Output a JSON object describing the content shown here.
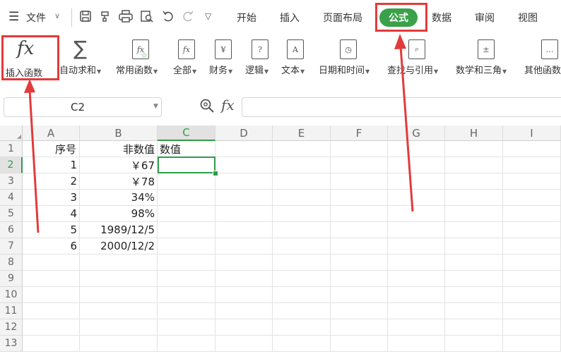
{
  "menubar": {
    "file_label": "文件",
    "tabs": [
      "开始",
      "插入",
      "页面布局",
      "公式",
      "数据",
      "审阅",
      "视图"
    ],
    "active_tab": "公式"
  },
  "ribbon": {
    "items": [
      {
        "label": "插入函数",
        "icon": "fx-icon"
      },
      {
        "label": "自动求和",
        "icon": "sigma-icon"
      },
      {
        "label": "常用函数",
        "icon": "star-fx-icon"
      },
      {
        "label": "全部",
        "icon": "fx-book-icon"
      },
      {
        "label": "财务",
        "icon": "yen-book-icon"
      },
      {
        "label": "逻辑",
        "icon": "question-book-icon"
      },
      {
        "label": "文本",
        "icon": "text-book-icon"
      },
      {
        "label": "日期和时间",
        "icon": "clock-book-icon"
      },
      {
        "label": "查找与引用",
        "icon": "magnifier-book-icon"
      },
      {
        "label": "数学和三角",
        "icon": "plusminus-book-icon"
      },
      {
        "label": "其他函数",
        "icon": "more-book-icon"
      }
    ],
    "fx_symbol": "fx"
  },
  "formula_bar": {
    "name_box": "C2",
    "fx_label": "fx",
    "formula": ""
  },
  "sheet": {
    "columns": [
      "A",
      "B",
      "C",
      "D",
      "E",
      "F",
      "G",
      "H",
      "I"
    ],
    "rows": [
      "1",
      "2",
      "3",
      "4",
      "5",
      "6",
      "7",
      "8",
      "9",
      "10",
      "11",
      "12",
      "13"
    ],
    "cells": {
      "A1": "序号",
      "B1": "非数值",
      "C1": "数值",
      "A2": "1",
      "B2": "￥67",
      "A3": "2",
      "B3": "￥78",
      "A4": "3",
      "B4": "34%",
      "A5": "4",
      "B5": "98%",
      "A6": "5",
      "B6": "1989/12/5",
      "A7": "6",
      "B7": "2000/12/2"
    },
    "selected_cell": "C2"
  },
  "colors": {
    "active_tab_bg": "#3aa14a",
    "highlight_red": "#e23b3b",
    "selection_green": "#2e9e49"
  }
}
